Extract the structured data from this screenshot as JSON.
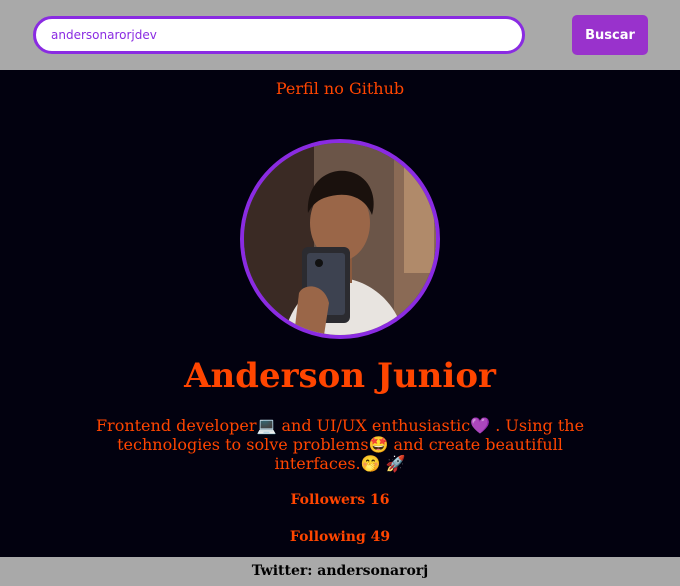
{
  "search": {
    "value": "andersonarorjdev",
    "button_label": "Buscar"
  },
  "profile": {
    "heading": "Perfil no Github",
    "name": "Anderson Junior",
    "bio": "Frontend developer💻 and UI/UX enthusiastic💜 . Using the technologies to solve problems🤩 and create beautifull interfaces.🤭 🚀",
    "followers_label": "Followers",
    "followers_count": "16",
    "following_label": "Following",
    "following_count": "49",
    "avatar_icon": "avatar-photo"
  },
  "footer": {
    "twitter": "Twitter: andersonarorj"
  },
  "colors": {
    "background": "#02010f",
    "bar": "#a9a9a9",
    "accent_purple": "#8a2be2",
    "button": "#9932cc",
    "text_orange": "#ff4500"
  }
}
